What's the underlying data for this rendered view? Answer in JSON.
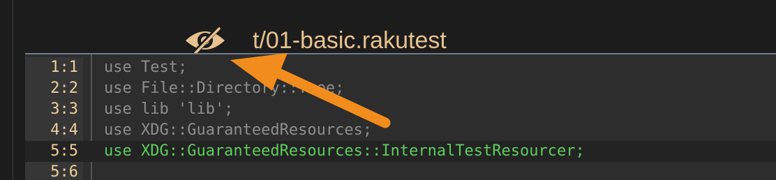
{
  "header": {
    "file_title": "t/01-basic.rakutest",
    "icon": "eye-slash-icon"
  },
  "editor": {
    "lines": [
      {
        "number": "1:1",
        "code": "use Test;",
        "highlighted": false
      },
      {
        "number": "2:2",
        "code": "use File::Directory::Tree;",
        "highlighted": false
      },
      {
        "number": "3:3",
        "code": "use lib 'lib';",
        "highlighted": false
      },
      {
        "number": "4:4",
        "code": "use XDG::GuaranteedResources;",
        "highlighted": false
      },
      {
        "number": "5:5",
        "code": "use XDG::GuaranteedResources::InternalTestResourcer;",
        "highlighted": true
      },
      {
        "number": "5:6",
        "code": "",
        "highlighted": false
      }
    ]
  },
  "colors": {
    "title": "#e8c28f",
    "line_number": "#f0cf9b",
    "code_dim": "#8e8e8e",
    "code_highlight": "#5ccd5c",
    "arrow": "#f28c1c"
  }
}
